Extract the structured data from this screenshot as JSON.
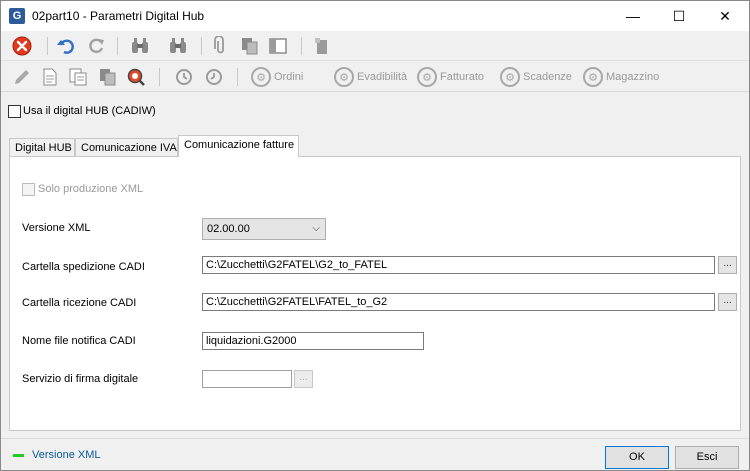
{
  "window": {
    "title": "02part10 - Parametri Digital Hub",
    "app_icon": "G",
    "minimize_glyph": "—",
    "maximize_glyph": "☐",
    "close_glyph": "✕"
  },
  "toolbar2": {
    "ordini": "Ordini",
    "evadibilita": "Evadibilità",
    "fatturato": "Fatturato",
    "scadenze": "Scadenze",
    "magazzino": "Magazzino"
  },
  "usa_digital_hub": {
    "label": "Usa il digital HUB (CADIW)",
    "checked": false
  },
  "tabs": [
    {
      "label": "Digital HUB",
      "active": false
    },
    {
      "label": "Comunicazione IVA",
      "active": false
    },
    {
      "label": "Comunicazione fatture",
      "active": true
    }
  ],
  "form": {
    "solo_xml": {
      "label": "Solo produzione XML",
      "checked": false,
      "enabled": false
    },
    "versione_xml": {
      "label": "Versione XML",
      "value": "02.00.00"
    },
    "cartella_spedizione": {
      "label": "Cartella spedizione CADI",
      "value": "C:\\Zucchetti\\G2FATEL\\G2_to_FATEL"
    },
    "cartella_ricezione": {
      "label": "Cartella ricezione CADI",
      "value": "C:\\Zucchetti\\G2FATEL\\FATEL_to_G2"
    },
    "nome_file_notifica": {
      "label": "Nome file notifica CADI",
      "value": "liquidazioni.G2000"
    },
    "servizio_firma": {
      "label": "Servizio di firma digitale",
      "value": ""
    },
    "browse_label": "..."
  },
  "status": {
    "text": "Versione XML"
  },
  "buttons": {
    "ok": "OK",
    "esci": "Esci"
  }
}
